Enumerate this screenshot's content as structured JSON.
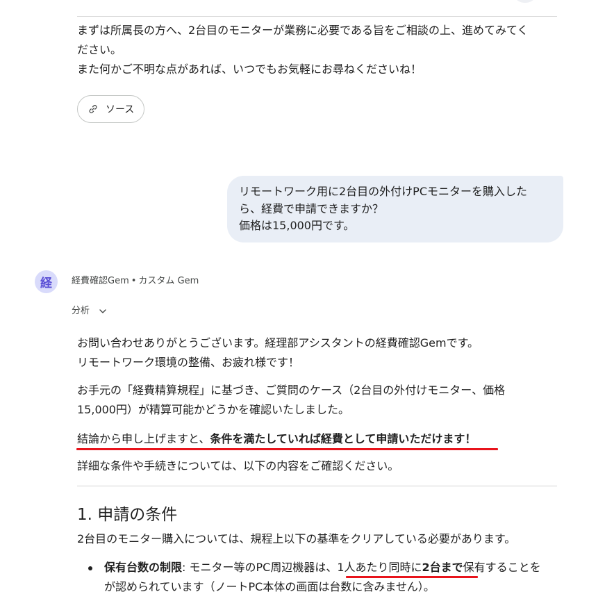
{
  "previous_response": {
    "line1": "まずは所属長の方へ、2台目のモニターが業務に必要である旨をご相談の上、進めてみてく",
    "line2": "ださい。",
    "line3": "また何かご不明な点があれば、いつでもお気軽にお尋ねくださいね！",
    "source_label": "ソース"
  },
  "user_message": {
    "line1": "リモートワーク用に2台目の外付けPCモニターを購入した",
    "line2": "ら、経費で申請できますか？",
    "line3": "価格は15,000円です。"
  },
  "gem": {
    "avatar_char": "経",
    "name": "経費確認Gem",
    "separator": "•",
    "type": "カスタム Gem",
    "analysis_label": "分析"
  },
  "response": {
    "p1_line1": "お問い合わせありがとうございます。経理部アシスタントの経費確認Gemです。",
    "p1_line2": "リモートワーク環境の整備、お疲れ様です！",
    "p2_line1": "お手元の「経費精算規程」に基づき、ご質問のケース（2台目の外付けモニター、価格",
    "p2_line2": "15,000円）が精算可能かどうかを確認いたしました。",
    "conclusion_prefix": "結論から申し上げますと、",
    "conclusion_bold": "条件を満たしていれば経費として申請いただけます！",
    "p4": "詳細な条件や手続きについては、以下の内容をご確認ください。",
    "section1_heading": "1. 申請の条件",
    "section1_intro": "2台目のモニター購入については、規程上以下の基準をクリアしている必要があります。",
    "bullet1_label": "保有台数の制限",
    "bullet1_colon": ": ",
    "bullet1_text_a": "モニター等のPC周辺機器は、",
    "bullet1_text_b": "1人あたり同時に",
    "bullet1_text_c": "2台まで",
    "bullet1_text_d": "保有することを",
    "bullet1_tail": "が認められています（ノートPC本体の画面は台数に含みません）。"
  },
  "colors": {
    "user_bubble": "#e9eef6",
    "avatar_bg": "#d9dbfb",
    "avatar_fg": "#5b50d6",
    "annotation_underline": "#e8141c"
  },
  "icons": {
    "source_chip": "link-icon",
    "analysis_toggle": "chevron-down-icon"
  }
}
